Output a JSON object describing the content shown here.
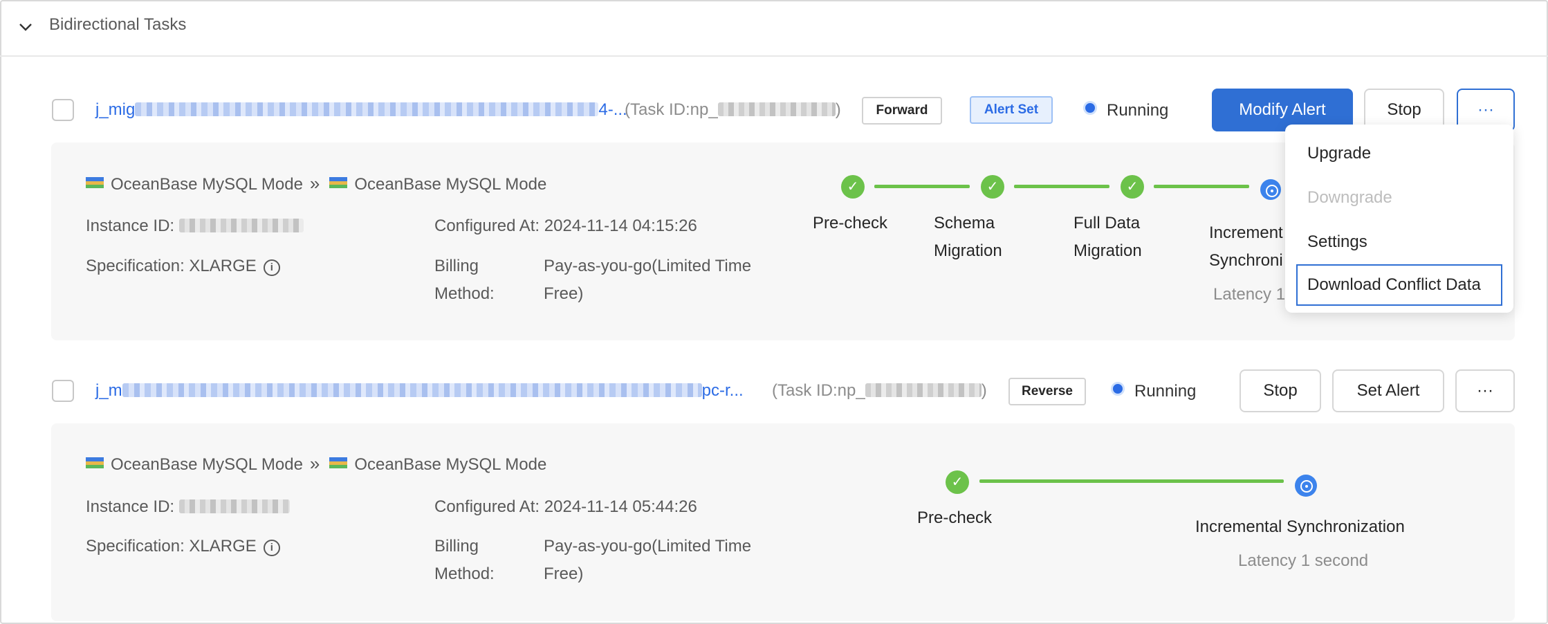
{
  "group": {
    "title": "Bidirectional Tasks",
    "collapse_icon": "chevron-down-icon"
  },
  "tasks": [
    {
      "name_prefix": "j_mig",
      "name_suffix": "4-...",
      "task_id_prefix": "(Task ID:np_",
      "task_id_suffix": ")",
      "direction": "Forward",
      "alert_tag": "Alert Set",
      "status": "Running",
      "actions": [
        "Modify Alert",
        "Stop",
        "···"
      ],
      "source_db": "OceanBase MySQL Mode",
      "target_db": "OceanBase MySQL Mode",
      "instance_label": "Instance ID:",
      "spec_label": "Specification:",
      "spec_value": "XLARGE",
      "configured_label": "Configured At:",
      "configured_value": "2024-11-14 04:15:26",
      "billing_label_1": "Billing",
      "billing_label_2": "Method:",
      "billing_value_1": "Pay-as-you-go(Limited Time",
      "billing_value_2": "Free)",
      "steps": [
        {
          "line1": "Pre-check",
          "line2": ""
        },
        {
          "line1": "Schema",
          "line2": "Migration"
        },
        {
          "line1": "Full Data",
          "line2": "Migration"
        },
        {
          "line1": "Increment",
          "line2": "Synchroni"
        }
      ],
      "latency": "Latency 1"
    },
    {
      "name_prefix": "j_m",
      "name_suffix": "pc-r...",
      "task_id_prefix": "(Task ID:np_",
      "task_id_suffix": ")",
      "direction": "Reverse",
      "status": "Running",
      "actions": [
        "Stop",
        "Set Alert",
        "···"
      ],
      "source_db": "OceanBase MySQL Mode",
      "target_db": "OceanBase MySQL Mode",
      "instance_label": "Instance ID:",
      "spec_label": "Specification:",
      "spec_value": "XLARGE",
      "configured_label": "Configured At:",
      "configured_value": "2024-11-14 05:44:26",
      "billing_label_1": "Billing",
      "billing_label_2": "Method:",
      "billing_value_1": "Pay-as-you-go(Limited Time",
      "billing_value_2": "Free)",
      "steps": [
        {
          "line1": "Pre-check"
        },
        {
          "line1": "Incremental Synchronization"
        }
      ],
      "latency": "Latency 1 second"
    }
  ],
  "dropdown": {
    "items": [
      {
        "label": "Upgrade",
        "disabled": false
      },
      {
        "label": "Downgrade",
        "disabled": true
      },
      {
        "label": "Settings",
        "disabled": false
      },
      {
        "label": "Download Conflict Data",
        "disabled": false,
        "focused": true
      }
    ]
  },
  "colors": {
    "accent": "#2f6fd4",
    "link": "#2b6be5",
    "success": "#6cc24a",
    "panel_bg": "#f7f7f7"
  }
}
